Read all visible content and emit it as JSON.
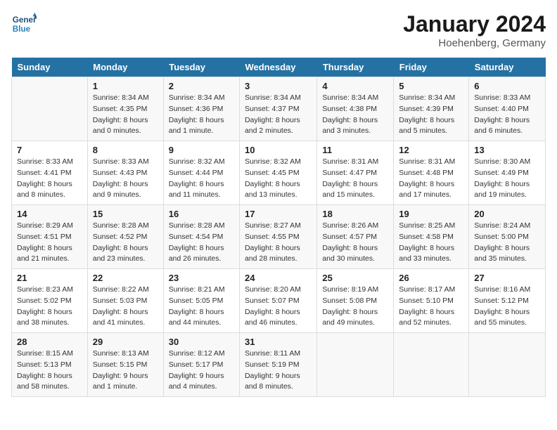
{
  "header": {
    "logo_line1": "General",
    "logo_line2": "Blue",
    "month": "January 2024",
    "location": "Hoehenberg, Germany"
  },
  "weekdays": [
    "Sunday",
    "Monday",
    "Tuesday",
    "Wednesday",
    "Thursday",
    "Friday",
    "Saturday"
  ],
  "weeks": [
    [
      {
        "day": "",
        "info": ""
      },
      {
        "day": "1",
        "info": "Sunrise: 8:34 AM\nSunset: 4:35 PM\nDaylight: 8 hours\nand 0 minutes."
      },
      {
        "day": "2",
        "info": "Sunrise: 8:34 AM\nSunset: 4:36 PM\nDaylight: 8 hours\nand 1 minute."
      },
      {
        "day": "3",
        "info": "Sunrise: 8:34 AM\nSunset: 4:37 PM\nDaylight: 8 hours\nand 2 minutes."
      },
      {
        "day": "4",
        "info": "Sunrise: 8:34 AM\nSunset: 4:38 PM\nDaylight: 8 hours\nand 3 minutes."
      },
      {
        "day": "5",
        "info": "Sunrise: 8:34 AM\nSunset: 4:39 PM\nDaylight: 8 hours\nand 5 minutes."
      },
      {
        "day": "6",
        "info": "Sunrise: 8:33 AM\nSunset: 4:40 PM\nDaylight: 8 hours\nand 6 minutes."
      }
    ],
    [
      {
        "day": "7",
        "info": "Sunrise: 8:33 AM\nSunset: 4:41 PM\nDaylight: 8 hours\nand 8 minutes."
      },
      {
        "day": "8",
        "info": "Sunrise: 8:33 AM\nSunset: 4:43 PM\nDaylight: 8 hours\nand 9 minutes."
      },
      {
        "day": "9",
        "info": "Sunrise: 8:32 AM\nSunset: 4:44 PM\nDaylight: 8 hours\nand 11 minutes."
      },
      {
        "day": "10",
        "info": "Sunrise: 8:32 AM\nSunset: 4:45 PM\nDaylight: 8 hours\nand 13 minutes."
      },
      {
        "day": "11",
        "info": "Sunrise: 8:31 AM\nSunset: 4:47 PM\nDaylight: 8 hours\nand 15 minutes."
      },
      {
        "day": "12",
        "info": "Sunrise: 8:31 AM\nSunset: 4:48 PM\nDaylight: 8 hours\nand 17 minutes."
      },
      {
        "day": "13",
        "info": "Sunrise: 8:30 AM\nSunset: 4:49 PM\nDaylight: 8 hours\nand 19 minutes."
      }
    ],
    [
      {
        "day": "14",
        "info": "Sunrise: 8:29 AM\nSunset: 4:51 PM\nDaylight: 8 hours\nand 21 minutes."
      },
      {
        "day": "15",
        "info": "Sunrise: 8:28 AM\nSunset: 4:52 PM\nDaylight: 8 hours\nand 23 minutes."
      },
      {
        "day": "16",
        "info": "Sunrise: 8:28 AM\nSunset: 4:54 PM\nDaylight: 8 hours\nand 26 minutes."
      },
      {
        "day": "17",
        "info": "Sunrise: 8:27 AM\nSunset: 4:55 PM\nDaylight: 8 hours\nand 28 minutes."
      },
      {
        "day": "18",
        "info": "Sunrise: 8:26 AM\nSunset: 4:57 PM\nDaylight: 8 hours\nand 30 minutes."
      },
      {
        "day": "19",
        "info": "Sunrise: 8:25 AM\nSunset: 4:58 PM\nDaylight: 8 hours\nand 33 minutes."
      },
      {
        "day": "20",
        "info": "Sunrise: 8:24 AM\nSunset: 5:00 PM\nDaylight: 8 hours\nand 35 minutes."
      }
    ],
    [
      {
        "day": "21",
        "info": "Sunrise: 8:23 AM\nSunset: 5:02 PM\nDaylight: 8 hours\nand 38 minutes."
      },
      {
        "day": "22",
        "info": "Sunrise: 8:22 AM\nSunset: 5:03 PM\nDaylight: 8 hours\nand 41 minutes."
      },
      {
        "day": "23",
        "info": "Sunrise: 8:21 AM\nSunset: 5:05 PM\nDaylight: 8 hours\nand 44 minutes."
      },
      {
        "day": "24",
        "info": "Sunrise: 8:20 AM\nSunset: 5:07 PM\nDaylight: 8 hours\nand 46 minutes."
      },
      {
        "day": "25",
        "info": "Sunrise: 8:19 AM\nSunset: 5:08 PM\nDaylight: 8 hours\nand 49 minutes."
      },
      {
        "day": "26",
        "info": "Sunrise: 8:17 AM\nSunset: 5:10 PM\nDaylight: 8 hours\nand 52 minutes."
      },
      {
        "day": "27",
        "info": "Sunrise: 8:16 AM\nSunset: 5:12 PM\nDaylight: 8 hours\nand 55 minutes."
      }
    ],
    [
      {
        "day": "28",
        "info": "Sunrise: 8:15 AM\nSunset: 5:13 PM\nDaylight: 8 hours\nand 58 minutes."
      },
      {
        "day": "29",
        "info": "Sunrise: 8:13 AM\nSunset: 5:15 PM\nDaylight: 9 hours\nand 1 minute."
      },
      {
        "day": "30",
        "info": "Sunrise: 8:12 AM\nSunset: 5:17 PM\nDaylight: 9 hours\nand 4 minutes."
      },
      {
        "day": "31",
        "info": "Sunrise: 8:11 AM\nSunset: 5:19 PM\nDaylight: 9 hours\nand 8 minutes."
      },
      {
        "day": "",
        "info": ""
      },
      {
        "day": "",
        "info": ""
      },
      {
        "day": "",
        "info": ""
      }
    ]
  ]
}
